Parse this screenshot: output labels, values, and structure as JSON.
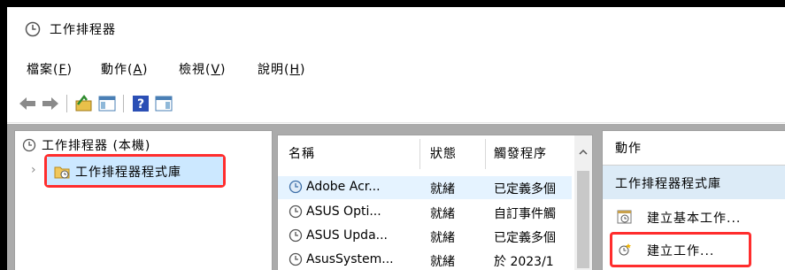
{
  "window": {
    "title": "工作排程器"
  },
  "menu": [
    {
      "label": "檔案(",
      "key": "F",
      "end": ")"
    },
    {
      "label": "動作(",
      "key": "A",
      "end": ")"
    },
    {
      "label": "檢視(",
      "key": "V",
      "end": ")"
    },
    {
      "label": "說明(",
      "key": "H",
      "end": ")"
    }
  ],
  "toolbar": {
    "icons": [
      "back-arrow-icon",
      "forward-arrow-icon",
      "up-folder-icon",
      "show-hide-console-tree-icon",
      "help-icon",
      "show-hide-action-pane-icon"
    ]
  },
  "tree": {
    "root_label": "工作排程器 (本機)",
    "library_label": "工作排程器程式庫"
  },
  "list": {
    "columns": [
      "名稱",
      "狀態",
      "觸發程序"
    ],
    "rows": [
      {
        "name": "Adobe Acr...",
        "status": "就緒",
        "trigger": "已定義多個"
      },
      {
        "name": "ASUS Opti...",
        "status": "就緒",
        "trigger": "自訂事件觸"
      },
      {
        "name": "ASUS Upda...",
        "status": "就緒",
        "trigger": "已定義多個"
      },
      {
        "name": "AsusSystem...",
        "status": "就緒",
        "trigger": "於 2023/1"
      }
    ]
  },
  "actions": {
    "header": "動作",
    "section": "工作排程器程式庫",
    "items": [
      {
        "label": "建立基本工作..."
      },
      {
        "label": "建立工作..."
      }
    ]
  },
  "colors": {
    "highlight_border": "#ff2d2d",
    "selection": "#cce8ff"
  }
}
